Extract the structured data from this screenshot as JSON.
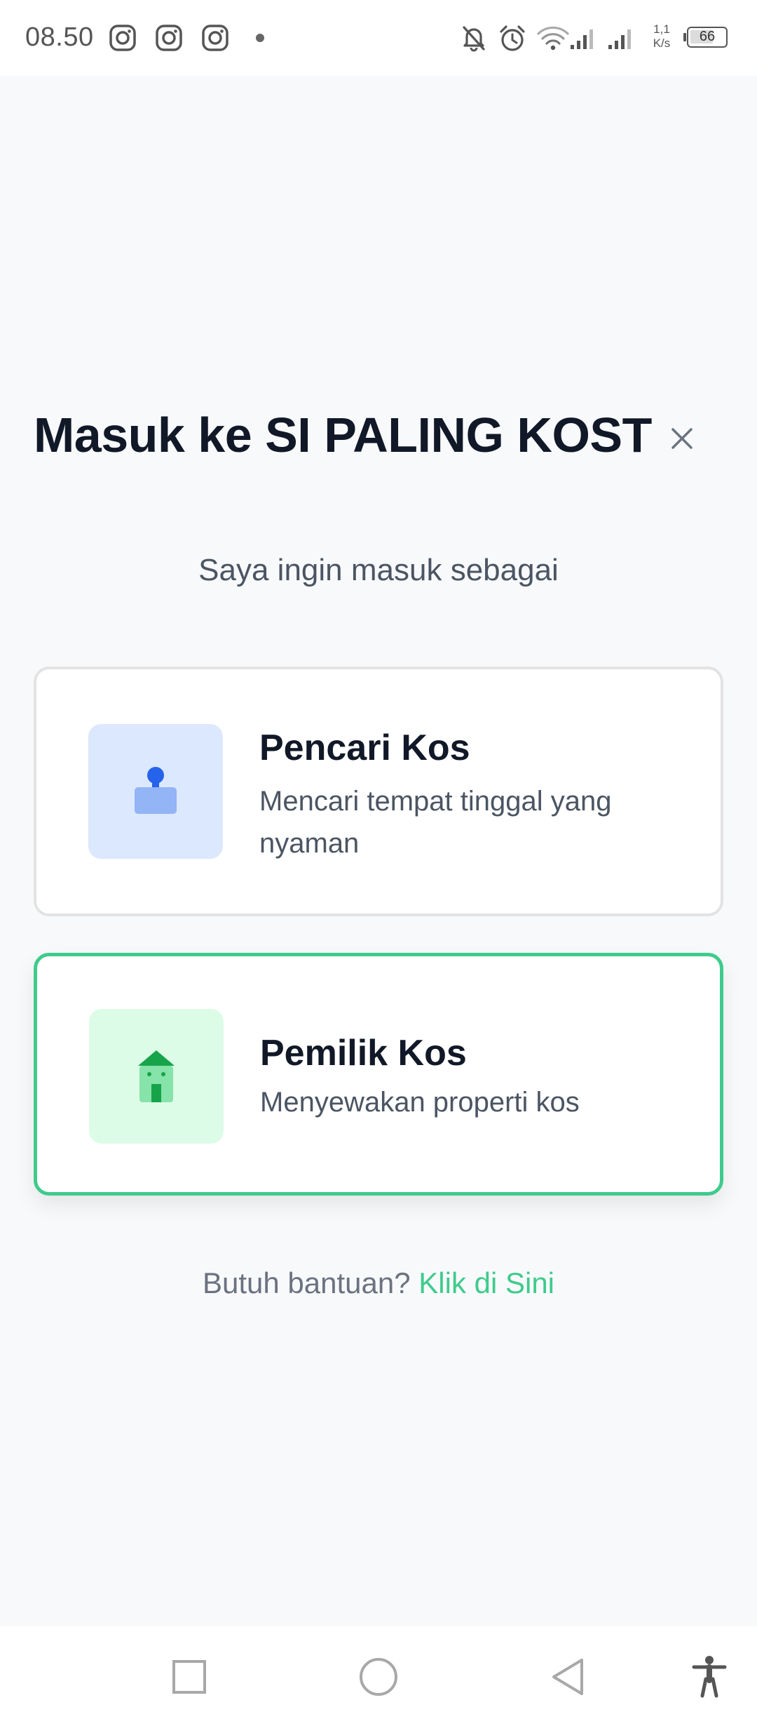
{
  "status_bar": {
    "time": "08.50",
    "net_speed_value": "1,1",
    "net_speed_unit": "K/s",
    "battery_level": "66",
    "icons": [
      "instagram-icon",
      "instagram-icon",
      "instagram-icon",
      "notification-dot",
      "bell-off-icon",
      "alarm-icon",
      "wifi-icon",
      "signal-icon",
      "signal-icon",
      "battery-icon"
    ]
  },
  "header": {
    "title": "Masuk ke SI PALING KOST",
    "close_icon": "close-icon"
  },
  "subtitle": "Saya ingin masuk sebagai",
  "roles": [
    {
      "title": "Pencari Kos",
      "description": "Mencari tempat tinggal yang nyaman",
      "icon": "person-icon",
      "selected": false,
      "icon_color": "#2563eb",
      "icon_bg": "#dce8fd"
    },
    {
      "title": "Pemilik Kos",
      "description": "Menyewakan properti kos",
      "icon": "house-icon",
      "selected": true,
      "icon_color": "#16a34a",
      "icon_bg": "#dcfce7"
    }
  ],
  "help": {
    "prefix": "Butuh bantuan?",
    "link": "Klik di Sini"
  },
  "colors": {
    "accent": "#3ecb8c",
    "title_text": "#111827",
    "body_text": "#4b5563",
    "background": "#f8f9fb"
  },
  "nav_bar": {
    "buttons": [
      "recents-button",
      "home-button",
      "back-button",
      "accessibility-button"
    ]
  }
}
